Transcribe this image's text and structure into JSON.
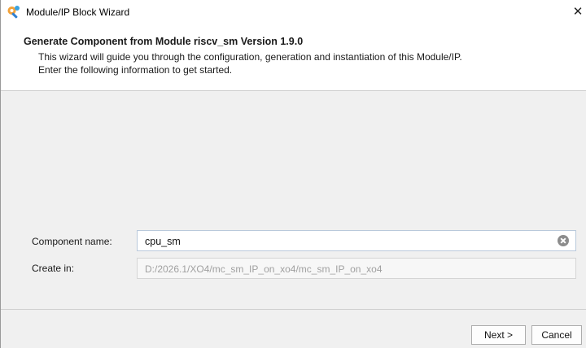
{
  "window": {
    "title": "Module/IP Block Wizard",
    "close_label": "✕"
  },
  "header": {
    "title": "Generate Component from Module riscv_sm Version 1.9.0",
    "description_line1": "This wizard will guide you through the configuration, generation and instantiation of this Module/IP.",
    "description_line2": "Enter the following information to get started."
  },
  "form": {
    "component_name_label": "Component name:",
    "component_name_value": "cpu_sm",
    "create_in_label": "Create in:",
    "create_in_value": "D:/2026.1/XO4/mc_sm_IP_on_xo4/mc_sm_IP_on_xo4"
  },
  "buttons": {
    "next_label": "Next >",
    "cancel_label": "Cancel"
  },
  "icons": {
    "app": "wrench-gear-icon",
    "clear": "clear-circle-icon"
  },
  "colors": {
    "window_bg": "#f0f0f0",
    "header_bg": "#ffffff"
  }
}
